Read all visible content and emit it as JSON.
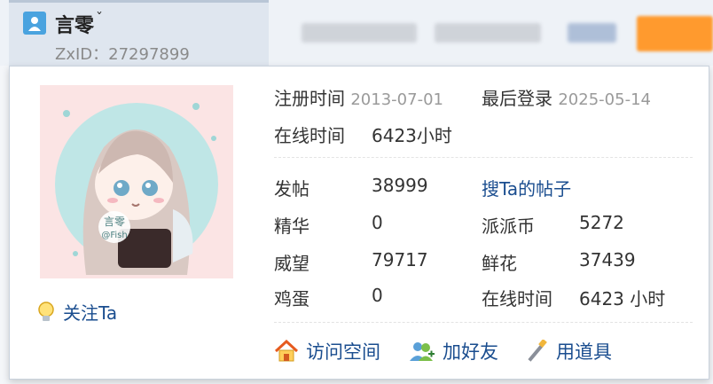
{
  "header": {
    "username": "言零",
    "zxid": "ZxID：27297899"
  },
  "card": {
    "register_label": "注册时间",
    "register_value": "2013-07-01",
    "last_login_label": "最后登录",
    "last_login_value": "2025-05-14",
    "online_label": "在线时间",
    "online_value": "6423小时",
    "stats": {
      "posts_label": "发帖",
      "posts_value": "38999",
      "search_posts": "搜Ta的帖子",
      "essence_label": "精华",
      "essence_value": "0",
      "coins_label": "派派币",
      "coins_value": "5272",
      "prestige_label": "威望",
      "prestige_value": "79717",
      "flowers_label": "鲜花",
      "flowers_value": "37439",
      "eggs_label": "鸡蛋",
      "eggs_value": "0",
      "online2_label": "在线时间",
      "online2_value": "6423 小时"
    },
    "follow": "关注Ta",
    "actions": {
      "visit_space": "访问空间",
      "add_friend": "加好友",
      "use_item": "用道具"
    },
    "avatar_text": "言零",
    "avatar_subtext": "@Fish"
  }
}
